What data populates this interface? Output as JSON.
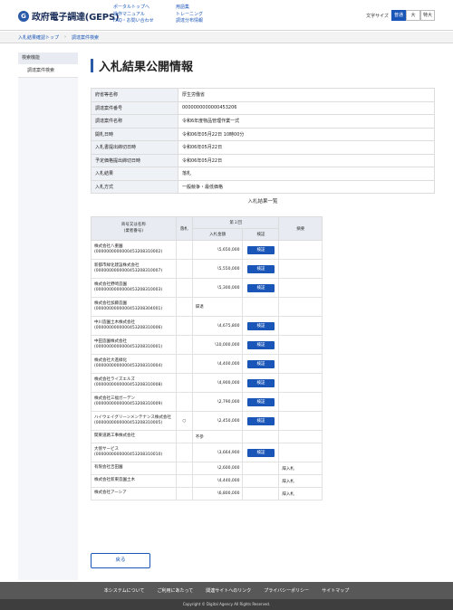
{
  "header": {
    "logo_mark": "G",
    "logo_text": "政府電子調達(GEPS)",
    "links_col1": [
      "ポータルトップへ",
      "操作マニュアル",
      "FAQ・お問い合わせ"
    ],
    "links_col2": [
      "用語集",
      "トレーニング",
      "調達分布情報"
    ],
    "font_size_label": "文字サイズ",
    "font_sizes": [
      "普通",
      "大",
      "特大"
    ]
  },
  "breadcrumb": [
    "入札結果確認トップ",
    "調達案件検索"
  ],
  "sidebar": {
    "heading": "検索機能",
    "items": [
      "調達案件検索"
    ]
  },
  "page_title": "入札結果公開情報",
  "info": [
    {
      "label": "府省等名称",
      "value": "厚生労働省"
    },
    {
      "label": "調達案件番号",
      "value": "0000000000000453206"
    },
    {
      "label": "調達案件名称",
      "value": "令和6年度物品管理作業一式"
    },
    {
      "label": "開札日時",
      "value": "令和06年05月22日 10時00分"
    },
    {
      "label": "入札書提出締切日時",
      "value": "令和06年05月22日"
    },
    {
      "label": "予定価格提出締切日時",
      "value": "令和06年05月22日"
    },
    {
      "label": "入札結果",
      "value": "落札"
    },
    {
      "label": "入札方式",
      "value": "一般競争・最低価格"
    }
  ],
  "results_title": "入札結果一覧",
  "results_header": {
    "name": "商号又は名称\n(業者番号)",
    "dropout": "落札",
    "round": "第１回",
    "amount": "入札金額",
    "check": "検証",
    "remarks": "摘要"
  },
  "check_label": "検証",
  "results": [
    {
      "name": "株式会社八重園",
      "num": "(0000000000000453208310002)",
      "dropout": "",
      "amount": "\\5,650,000",
      "check": true,
      "remarks": ""
    },
    {
      "name": "新都市緑化建設株式会社",
      "num": "(0000000000000453208310007)",
      "dropout": "",
      "amount": "\\5,550,000",
      "check": true,
      "remarks": ""
    },
    {
      "name": "株式会社野崎造園",
      "num": "(0000000000000453208310003)",
      "dropout": "",
      "amount": "\\5,300,000",
      "check": true,
      "remarks": ""
    },
    {
      "name": "株式会社加藤造園",
      "num": "(0000000000000453208304001)",
      "dropout": "",
      "amount": "辞退",
      "check": false,
      "remarks": ""
    },
    {
      "name": "中川造園土木株式会社",
      "num": "(0000000000000453208310006)",
      "dropout": "",
      "amount": "\\4,675,800",
      "check": true,
      "remarks": ""
    },
    {
      "name": "中田造園株式会社",
      "num": "(0000000000000453208310001)",
      "dropout": "",
      "amount": "\\10,000,000",
      "check": true,
      "remarks": ""
    },
    {
      "name": "株式会社大進緑化",
      "num": "(0000000000000453208310004)",
      "dropout": "",
      "amount": "\\4,400,000",
      "check": true,
      "remarks": ""
    },
    {
      "name": "株式会社ライズエルズ",
      "num": "(0000000000000453208310008)",
      "dropout": "",
      "amount": "\\4,900,000",
      "check": true,
      "remarks": ""
    },
    {
      "name": "株式会社三福ガーデン",
      "num": "(0000000000000453208310009)",
      "dropout": "",
      "amount": "\\2,790,000",
      "check": true,
      "remarks": ""
    },
    {
      "name": "ハイウェイグリーンメンテナンス株式会社",
      "num": "(0000000000000453208310005)",
      "dropout": "○",
      "amount": "\\2,450,000",
      "check": true,
      "remarks": ""
    },
    {
      "name": "関東道路工事株式会社",
      "num": "",
      "dropout": "",
      "amount": "不参",
      "check": false,
      "remarks": ""
    },
    {
      "name": "大傍サービス",
      "num": "(0000000000000453208310010)",
      "dropout": "",
      "amount": "\\3,664,900",
      "check": true,
      "remarks": ""
    },
    {
      "name": "有限会社吉田園",
      "num": "",
      "dropout": "",
      "amount": "\\2,600,000",
      "check": false,
      "remarks": "辞入札"
    },
    {
      "name": "株式会社新東造園土木",
      "num": "",
      "dropout": "",
      "amount": "\\4,440,000",
      "check": false,
      "remarks": "辞入札"
    },
    {
      "name": "株式会社アーシア",
      "num": "",
      "dropout": "",
      "amount": "\\6,800,000",
      "check": false,
      "remarks": "辞入札"
    }
  ],
  "back_label": "戻る",
  "footer": {
    "links": [
      "本システムについて",
      "ご利用にあたって",
      "関連サイトへのリンク",
      "プライバシーポリシー",
      "サイトマップ"
    ],
    "copyright": "Copyright © Digital Agency All Rights Reserved."
  }
}
